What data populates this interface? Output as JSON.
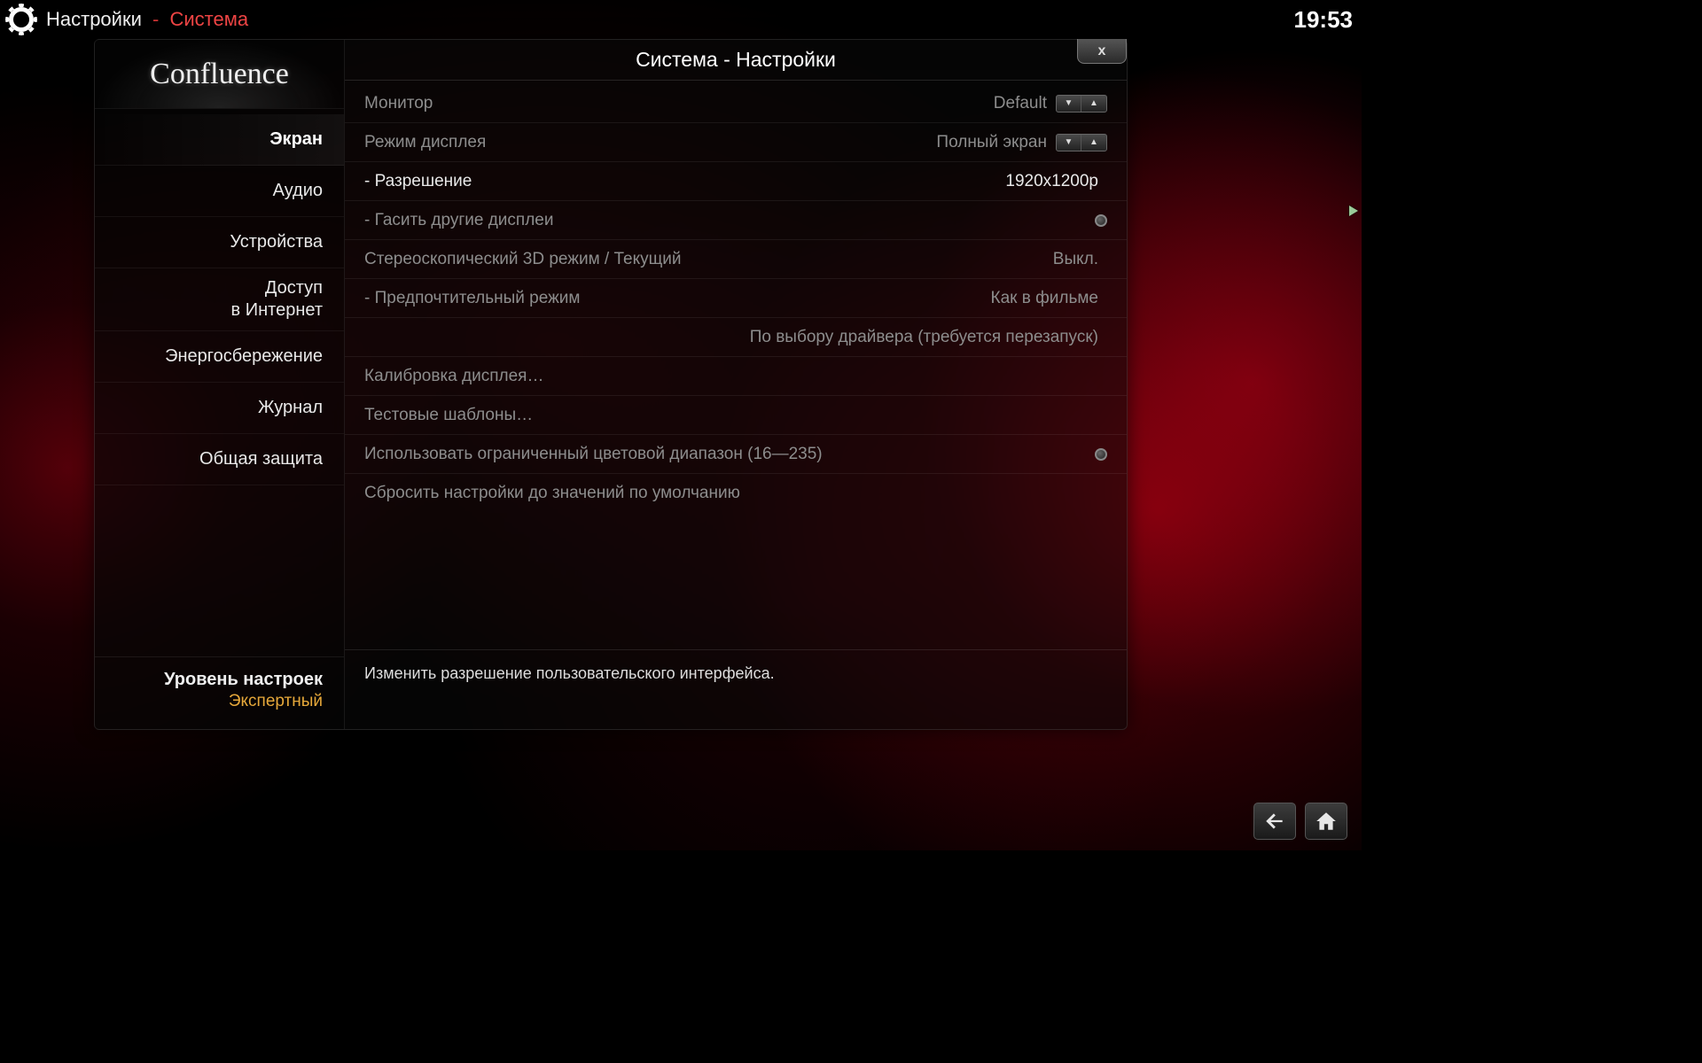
{
  "breadcrumb": {
    "root": "Настройки",
    "current": "Система"
  },
  "clock": "19:53",
  "logo": "Confluence",
  "panel_title": "Система - Настройки",
  "close_label": "x",
  "sidebar": {
    "items": [
      {
        "label": "Экран",
        "active": true
      },
      {
        "label": "Аудио"
      },
      {
        "label": "Устройства"
      },
      {
        "label": "Доступ\nв Интернет",
        "multiline": true
      },
      {
        "label": "Энергосбережение"
      },
      {
        "label": "Журнал"
      },
      {
        "label": "Общая защита"
      }
    ],
    "level_label": "Уровень настроек",
    "level_value": "Экспертный"
  },
  "rows": {
    "monitor": {
      "label": "Монитор",
      "value": "Default"
    },
    "display_mode": {
      "label": "Режим дисплея",
      "value": "Полный экран"
    },
    "resolution": {
      "label": "- Разрешение",
      "value": "1920x1200p"
    },
    "blank_other": {
      "label": "- Гасить другие дисплеи"
    },
    "stereo3d": {
      "label": "Стереоскопический 3D режим / Текущий",
      "value": "Выкл."
    },
    "preferred_mode": {
      "label": "- Предпочтительный режим",
      "value": "Как в фильме"
    },
    "driver_choice": {
      "value": "По выбору драйвера (требуется перезапуск)"
    },
    "calibration": {
      "label": "Калибровка дисплея…"
    },
    "test_patterns": {
      "label": "Тестовые шаблоны…"
    },
    "limited_range": {
      "label": "Использовать ограниченный цветовой диапазон (16—235)"
    },
    "reset": {
      "label": "Сбросить настройки до значений по умолчанию"
    }
  },
  "hint": "Изменить разрешение пользовательского интерфейса."
}
